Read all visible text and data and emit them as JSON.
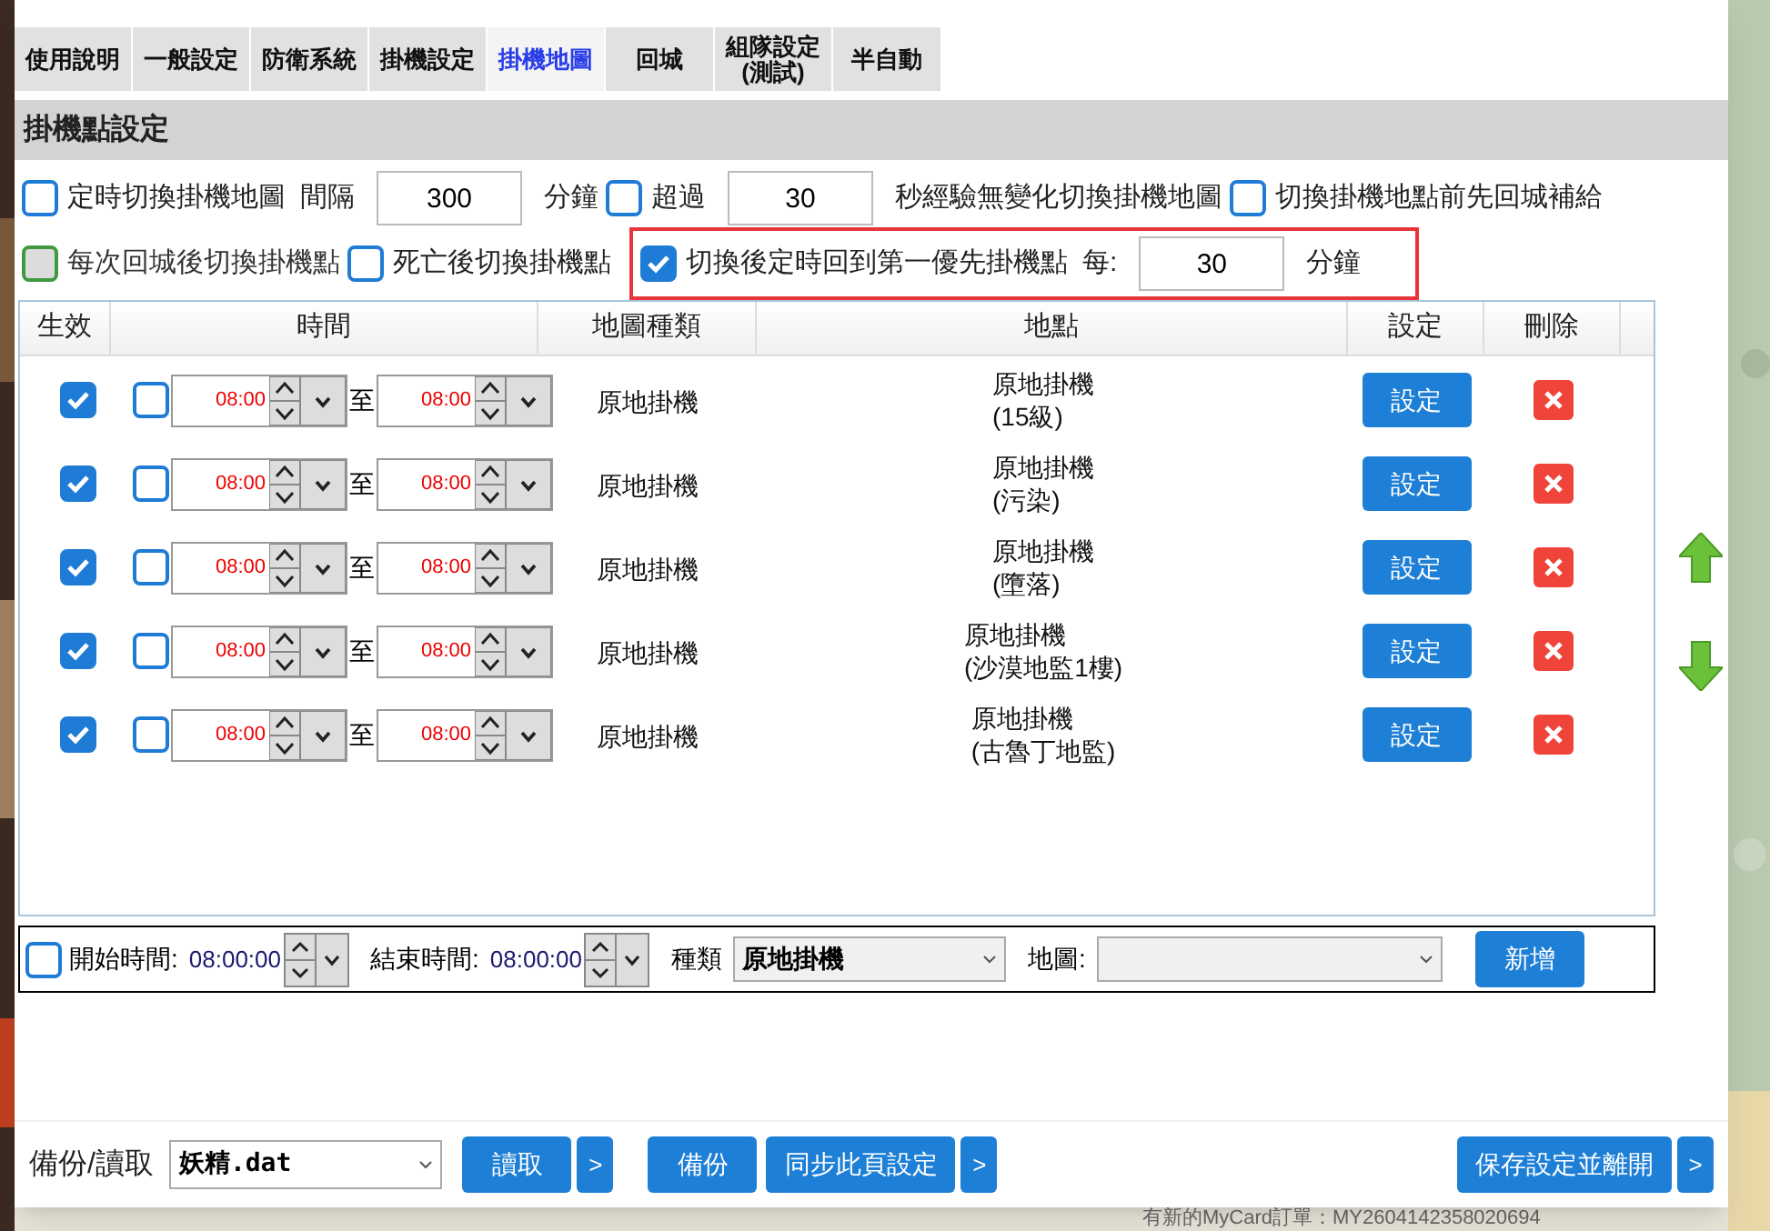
{
  "tabs": [
    {
      "label": "使用說明",
      "selected": false
    },
    {
      "label": "一般設定",
      "selected": false
    },
    {
      "label": "防衛系統",
      "selected": false
    },
    {
      "label": "掛機設定",
      "selected": false
    },
    {
      "label": "掛機地圖",
      "selected": true
    },
    {
      "label": "回城",
      "selected": false
    },
    {
      "label": "組隊設定\n(測試)",
      "selected": false
    },
    {
      "label": "半自動",
      "selected": false
    }
  ],
  "section_title": "掛機點設定",
  "option_rows": [
    {
      "items": [
        {
          "kind": "checkbox",
          "label": "定時切換掛機地圖",
          "checked": false,
          "disabled": false
        },
        {
          "kind": "text",
          "label": "間隔"
        },
        {
          "kind": "field",
          "value": "300"
        },
        {
          "kind": "text",
          "label": "分鐘"
        },
        {
          "kind": "checkbox",
          "label": "超過",
          "checked": false,
          "disabled": false
        },
        {
          "kind": "field",
          "value": "30"
        },
        {
          "kind": "text",
          "label": "秒經驗無變化切換掛機地圖"
        },
        {
          "kind": "checkbox",
          "label": "切換掛機地點前先回城補給",
          "checked": false,
          "disabled": false
        }
      ]
    },
    {
      "items": [
        {
          "kind": "checkbox",
          "label": "每次回城後切換掛機點",
          "checked": false,
          "disabled": true
        },
        {
          "kind": "checkbox",
          "label": "死亡後切換掛機點",
          "checked": false,
          "disabled": false
        },
        {
          "kind": "group",
          "highlighted": true,
          "items": [
            {
              "kind": "checkbox",
              "label": "切換後定時回到第一優先掛機點",
              "checked": true,
              "disabled": false
            },
            {
              "kind": "text",
              "label": "每:"
            },
            {
              "kind": "field",
              "value": "30"
            },
            {
              "kind": "text",
              "label": "分鐘"
            }
          ]
        }
      ]
    }
  ],
  "table": {
    "columns": [
      "生效",
      "時間",
      "地圖種類",
      "地點",
      "設定",
      "刪除"
    ],
    "rows": [
      {
        "enabled": true,
        "time_limited": false,
        "start": "08:00",
        "separator": "至",
        "end": "08:00",
        "map_type": "原地掛機",
        "location": "原地掛機\n(15級)",
        "button": "設定"
      },
      {
        "enabled": true,
        "time_limited": false,
        "start": "08:00",
        "separator": "至",
        "end": "08:00",
        "map_type": "原地掛機",
        "location": "原地掛機\n(污染)",
        "button": "設定"
      },
      {
        "enabled": true,
        "time_limited": false,
        "start": "08:00",
        "separator": "至",
        "end": "08:00",
        "map_type": "原地掛機",
        "location": "原地掛機\n(墮落)",
        "button": "設定"
      },
      {
        "enabled": true,
        "time_limited": false,
        "start": "08:00",
        "separator": "至",
        "end": "08:00",
        "map_type": "原地掛機",
        "location": "原地掛機\n(沙漠地監1樓)",
        "button": "設定"
      },
      {
        "enabled": true,
        "time_limited": false,
        "start": "08:00",
        "separator": "至",
        "end": "08:00",
        "map_type": "原地掛機",
        "location": "原地掛機\n(古魯丁地監)",
        "button": "設定"
      }
    ]
  },
  "add_panel": {
    "checked": false,
    "start_label": "開始時間:",
    "start": "08:00:00",
    "end_label": "結束時間:",
    "end": "08:00:00",
    "type_label": "種類",
    "type_value": "原地掛機",
    "map_label": "地圖:",
    "button": "新增"
  },
  "footer": {
    "label": "備份/讀取",
    "file": "妖精.dat",
    "buttons": [
      {
        "kind": "main",
        "label": "讀取"
      },
      {
        "kind": "more",
        "label": ">"
      },
      {
        "kind": "main",
        "label": "備份"
      },
      {
        "kind": "main",
        "label": "同步此頁設定"
      },
      {
        "kind": "more",
        "label": ">"
      },
      {
        "kind": "spacer"
      },
      {
        "kind": "main",
        "label": "保存設定並離開"
      },
      {
        "kind": "more",
        "label": ">"
      }
    ]
  },
  "background_notice": "有新的MyCard訂單：MY2604142358020694"
}
